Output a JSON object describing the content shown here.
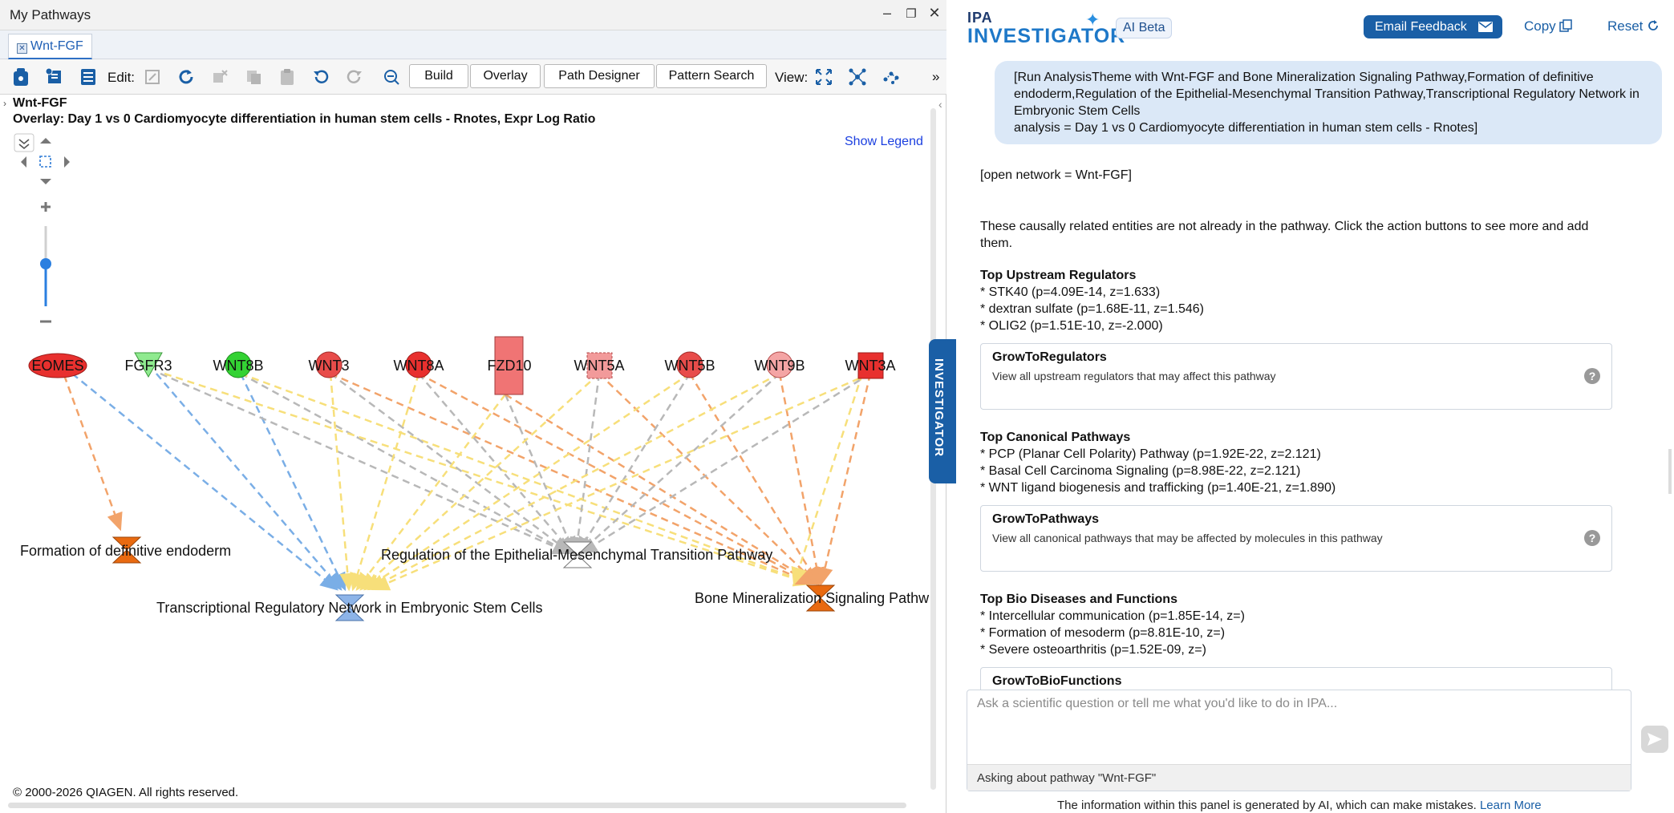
{
  "window": {
    "title": "My Pathways",
    "controls": [
      "–",
      "❐",
      "✕"
    ]
  },
  "tab": {
    "label": "Wnt-FGF"
  },
  "toolbar": {
    "edit_label": "Edit:",
    "view_label": "View:",
    "buttons": [
      "Build",
      "Overlay",
      "Path Designer",
      "Pattern Search"
    ],
    "more": "»"
  },
  "network": {
    "name": "Wnt-FGF",
    "overlay": "Overlay: Day 1 vs 0 Cardiomyocyte differentiation in human stem cells - Rnotes, Expr Log Ratio",
    "legend_link": "Show Legend",
    "nodes": [
      "EOMES",
      "FGFR3",
      "WNT8B",
      "WNT3",
      "WNT8A",
      "FZD10",
      "WNT5A",
      "WNT5B",
      "WNT9B",
      "WNT3A"
    ],
    "pathways": [
      "Formation of definitive endoderm",
      "Regulation of the Epithelial-Mesenchymal Transition Pathway",
      "Transcriptional Regulatory Network in Embryonic Stem Cells",
      "Bone Mineralization Signaling Pathw"
    ],
    "colors": {
      "red": "#e8302e",
      "light_red": "#f07474",
      "pale_red": "#f4a5a5",
      "green": "#33d233",
      "light_green": "#8fea8f",
      "orange": "#e96a10",
      "blue": "#8db4e8",
      "edge_orange": "#f2a36a",
      "edge_blue": "#7aaee6",
      "edge_yellow": "#f7df7a",
      "edge_gray": "#b8b8b8"
    }
  },
  "copyright": "© 2000-2026 QIAGEN. All rights reserved.",
  "investigator_tab": "INVESTIGATOR",
  "header": {
    "logo_top": "IPA",
    "logo_bottom": "INVESTIGATOR",
    "badge": "AI Beta",
    "feedback": "Email Feedback",
    "copy": "Copy",
    "reset": "Reset"
  },
  "chat": {
    "user_message": "[Run AnalysisTheme with Wnt-FGF and Bone Mineralization Signaling Pathway,Formation of definitive endoderm,Regulation of the Epithelial-Mesenchymal Transition Pathway,Transcriptional Regulatory Network in Embryonic Stem Cells\nanalysis = Day 1 vs 0 Cardiomyocyte differentiation in human stem cells - Rnotes]",
    "open_network": "[open network = Wnt-FGF]",
    "intro": "These causally related entities are not already in the pathway. Click the action buttons to see more and add them.",
    "sections": [
      {
        "heading": "Top Upstream Regulators",
        "items": [
          "* STK40 (p=4.09E-14, z=1.633)",
          "* dextran sulfate (p=1.68E-11, z=1.546)",
          "* OLIG2 (p=1.51E-10, z=-2.000)"
        ],
        "card_title": "GrowToRegulators",
        "card_desc": "View all upstream regulators that may affect this pathway"
      },
      {
        "heading": "Top Canonical Pathways",
        "items": [
          "* PCP (Planar Cell Polarity) Pathway (p=1.92E-22, z=2.121)",
          "* Basal Cell Carcinoma Signaling (p=8.98E-22, z=2.121)",
          "* WNT ligand biogenesis and trafficking (p=1.40E-21, z=1.890)"
        ],
        "card_title": "GrowToPathways",
        "card_desc": "View all canonical pathways that may be affected by molecules in this pathway"
      },
      {
        "heading": "Top Bio Diseases and Functions",
        "items": [
          "* Intercellular communication (p=1.85E-14, z=)",
          "* Formation of mesoderm (p=8.81E-10, z=)",
          "* Severe osteoarthritis (p=1.52E-09, z=)"
        ],
        "card_title": "GrowToBioFunctions",
        "card_desc": ""
      }
    ],
    "help": "?"
  },
  "input": {
    "placeholder": "Ask a scientific question or tell me what you'd like to do in IPA...",
    "context": "Asking about pathway \"Wnt-FGF\""
  },
  "disclaimer": {
    "text": "The information within this panel is generated by AI, which can make mistakes.",
    "link": "Learn More"
  }
}
